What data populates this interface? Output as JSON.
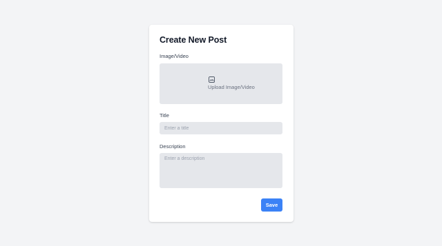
{
  "form": {
    "title": "Create New Post",
    "media": {
      "label": "Image/Video",
      "upload_text": "Upload Image/Video",
      "icon": "image-icon"
    },
    "post_title": {
      "label": "Title",
      "value": "",
      "placeholder": "Enter a title"
    },
    "description": {
      "label": "Description",
      "value": "",
      "placeholder": "Enter a description"
    },
    "save_label": "Save"
  },
  "colors": {
    "page_background": "#f3f4f6",
    "card_background": "#ffffff",
    "field_background": "#e5e7eb",
    "accent": "#3b82f6"
  }
}
